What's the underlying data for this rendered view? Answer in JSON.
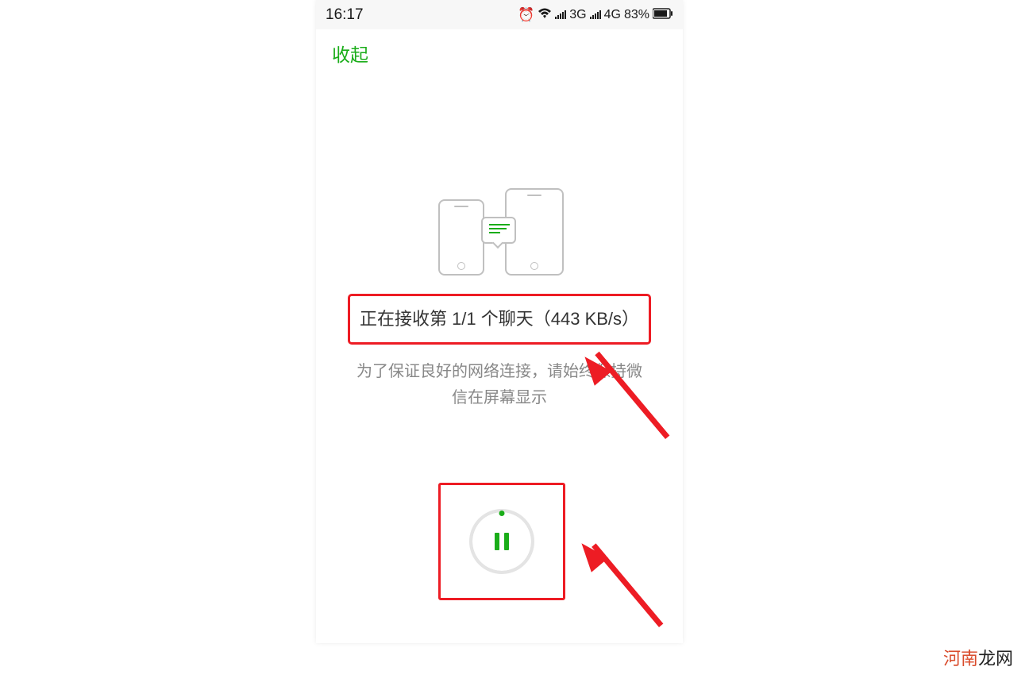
{
  "statusbar": {
    "time": "16:17",
    "network3g": "3G",
    "network4g": "4G",
    "battery": "83%"
  },
  "nav": {
    "back_label": "收起"
  },
  "transfer": {
    "status_text": "正在接收第 1/1 个聊天（443 KB/s）",
    "hint_text": "为了保证良好的网络连接，请始终保持微信在屏幕显示"
  },
  "watermark": {
    "part1": "河南",
    "part2": "龙网"
  }
}
